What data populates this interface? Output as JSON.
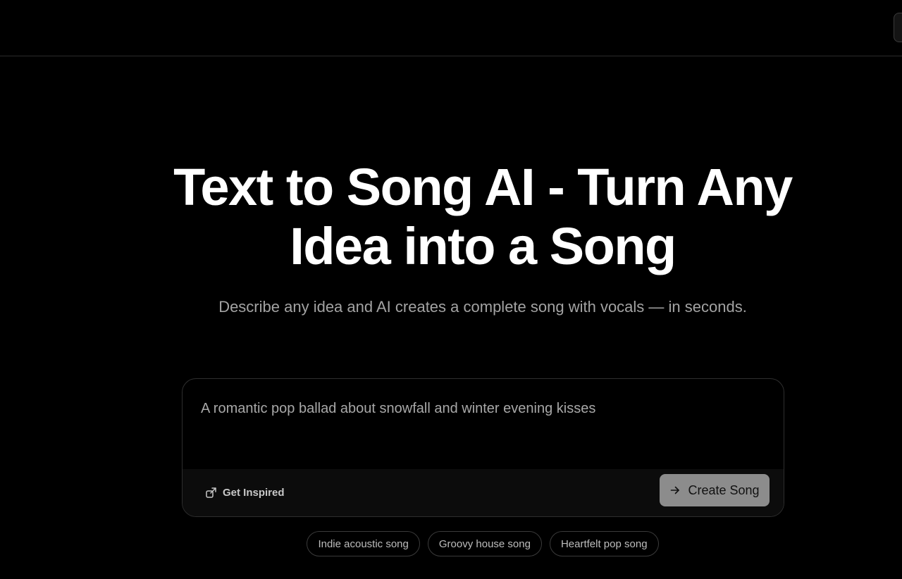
{
  "hero": {
    "title_line1": "Text to Song AI - Turn Any",
    "title_line2": "Idea into a Song",
    "subtitle": "Describe any idea and AI creates a complete song with vocals — in seconds."
  },
  "prompt": {
    "placeholder": "A romantic pop ballad about snowfall and winter evening kisses",
    "value": ""
  },
  "actions": {
    "inspire_label": "Get Inspired",
    "inspire_icon": "share-external-icon",
    "create_label": "Create Song",
    "create_icon": "arrow-right-icon"
  },
  "suggestions": [
    {
      "label": "Indie acoustic song"
    },
    {
      "label": "Groovy house song"
    },
    {
      "label": "Heartfelt pop song"
    }
  ],
  "colors": {
    "background": "#000000",
    "text_primary": "#ffffff",
    "text_muted": "#a3a3a3",
    "create_button_bg": "#8c8c8c",
    "border": "#2e2e2e"
  }
}
